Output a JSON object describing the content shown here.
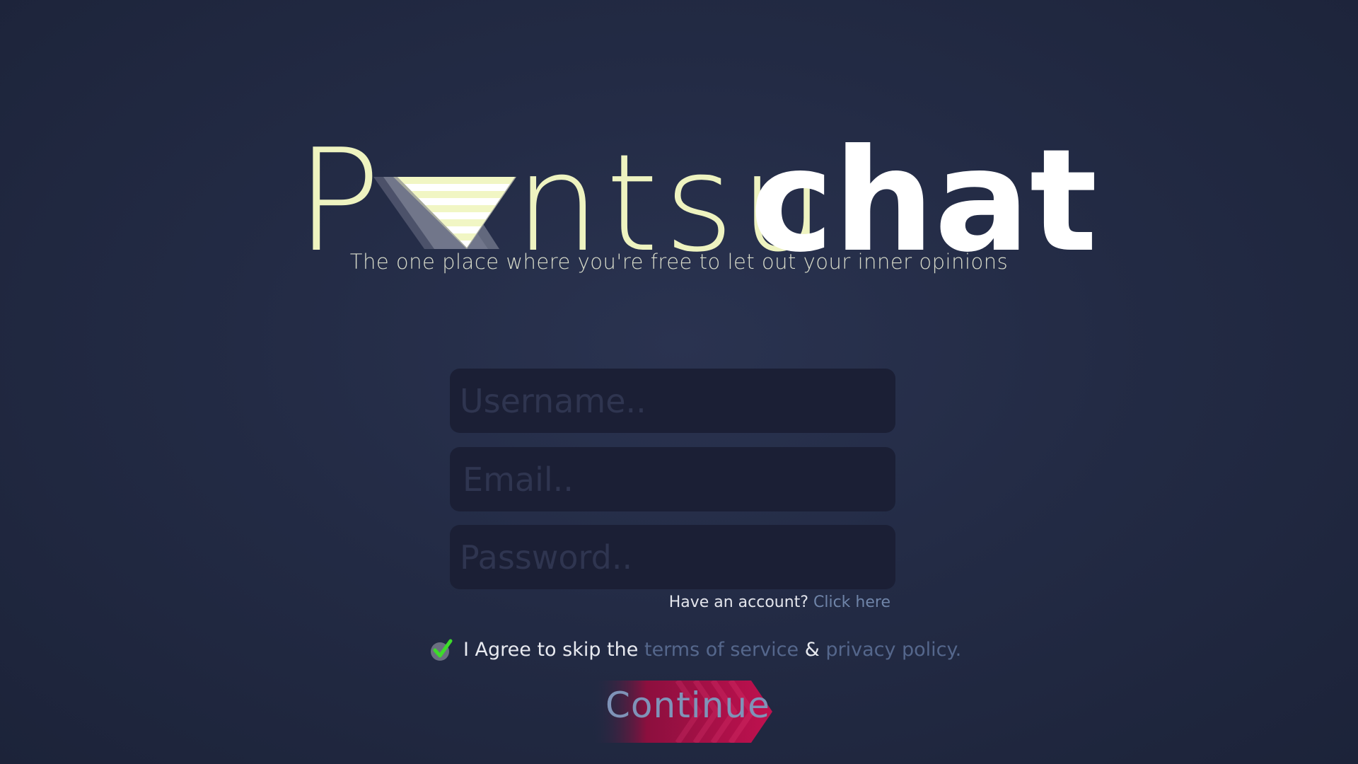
{
  "logo": {
    "letter_p": "P",
    "light_part": "ntsu",
    "bold_part": "chat",
    "tagline": "The one place where you're free to let out your inner opinions"
  },
  "form": {
    "username_placeholder": "Username..",
    "email_placeholder": "Email..",
    "password_placeholder": "Password..",
    "have_account_text": "Have an account?",
    "click_here_link": "Click here",
    "agree_prefix": "I Agree to skip the",
    "terms_link": "terms of service",
    "ampersand": "&",
    "privacy_link": "privacy policy.",
    "agree_checked": true,
    "continue_label": "Continue"
  },
  "colors": {
    "background": "#232b45",
    "logo_cream": "#eef3c0",
    "logo_white": "#ffffff",
    "field_bg": "#1b1f35",
    "link": "#6f84a8",
    "check_green": "#3ddc2a",
    "continue_pink": "#b0104a"
  }
}
